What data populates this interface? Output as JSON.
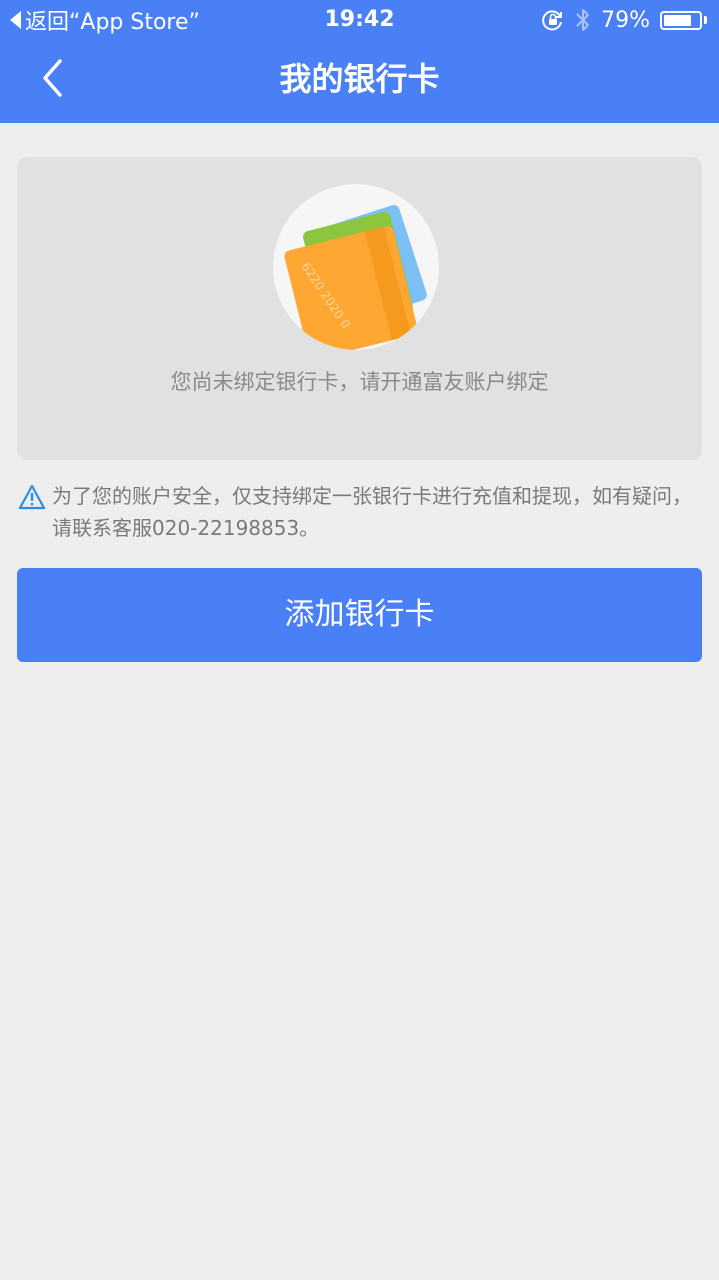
{
  "status_bar": {
    "back_to_app": "返回“App Store”",
    "time": "19:42",
    "battery_percent": "79%",
    "battery_level": 0.79,
    "icons": [
      "orientation-lock-icon",
      "bluetooth-icon",
      "battery-icon"
    ]
  },
  "nav": {
    "title": "我的银行卡",
    "back_icon": "chevron-left-icon"
  },
  "empty_state": {
    "message": "您尚未绑定银行卡，请开通富友账户绑定",
    "card_number_text": "6220 2020 0"
  },
  "notice": {
    "icon": "warning-icon",
    "text": "为了您的账户安全，仅支持绑定一张银行卡进行充值和提现，如有疑问，请联系客服020-22198853。"
  },
  "actions": {
    "add_card_label": "添加银行卡"
  },
  "colors": {
    "primary": "#4a80f5",
    "background": "#eeeeee",
    "card_orange": "#ffa733",
    "card_green": "#8cc63f",
    "card_blue": "#7cc0f5"
  }
}
